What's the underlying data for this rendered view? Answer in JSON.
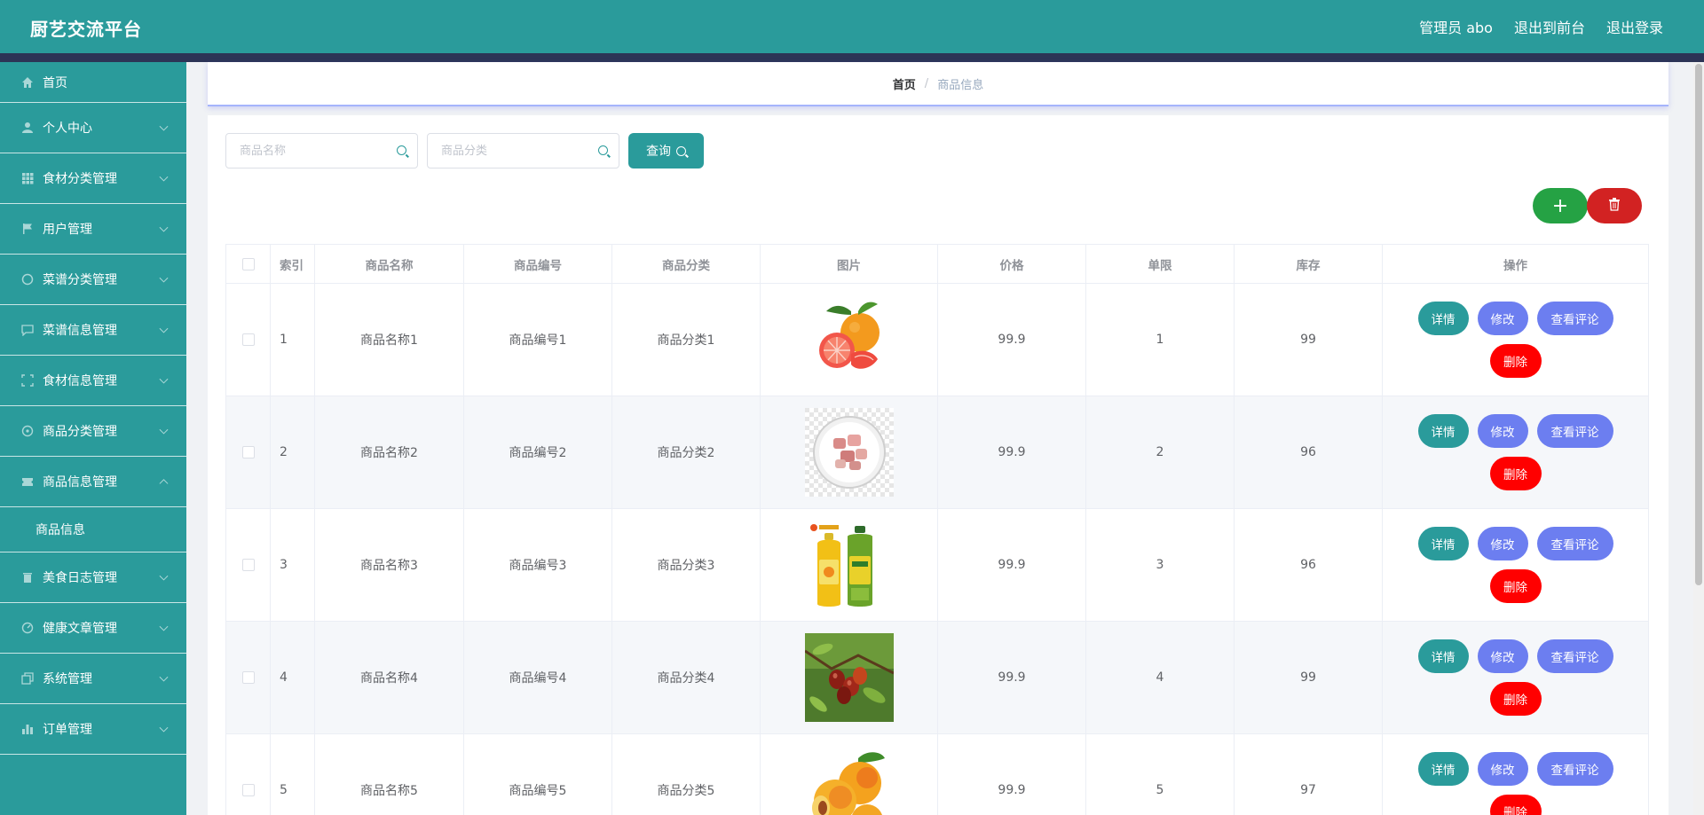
{
  "header": {
    "title": "厨艺交流平台",
    "user_label": "管理员 abo",
    "front_link": "退出到前台",
    "logout_link": "退出登录"
  },
  "sidebar": {
    "items": [
      {
        "label": "首页",
        "icon": "home-icon"
      },
      {
        "label": "个人中心",
        "icon": "user-icon"
      },
      {
        "label": "食材分类管理",
        "icon": "grid-icon"
      },
      {
        "label": "用户管理",
        "icon": "flag-icon"
      },
      {
        "label": "菜谱分类管理",
        "icon": "circle-icon"
      },
      {
        "label": "菜谱信息管理",
        "icon": "chat-icon"
      },
      {
        "label": "食材信息管理",
        "icon": "frame-icon"
      },
      {
        "label": "商品分类管理",
        "icon": "target-icon"
      },
      {
        "label": "商品信息管理",
        "icon": "ticket-icon"
      },
      {
        "label": "美食日志管理",
        "icon": "trash-icon"
      },
      {
        "label": "健康文章管理",
        "icon": "dashboard-icon"
      },
      {
        "label": "系统管理",
        "icon": "copy-icon"
      },
      {
        "label": "订单管理",
        "icon": "bars-icon"
      }
    ],
    "sub_item": "商品信息"
  },
  "breadcrumb": {
    "home": "首页",
    "sep": "/",
    "current": "商品信息"
  },
  "search": {
    "name_placeholder": "商品名称",
    "category_placeholder": "商品分类",
    "query_label": "查询"
  },
  "table": {
    "headers": [
      "索引",
      "商品名称",
      "商品编号",
      "商品分类",
      "图片",
      "价格",
      "单限",
      "库存",
      "操作"
    ],
    "rows": [
      {
        "index": "1",
        "name": "商品名称1",
        "code": "商品编号1",
        "category": "商品分类1",
        "image": "grapefruit",
        "price": "99.9",
        "limit": "1",
        "stock": "99"
      },
      {
        "index": "2",
        "name": "商品名称2",
        "code": "商品编号2",
        "category": "商品分类2",
        "image": "meat-plate",
        "price": "99.9",
        "limit": "2",
        "stock": "96"
      },
      {
        "index": "3",
        "name": "商品名称3",
        "code": "商品编号3",
        "category": "商品分类3",
        "image": "oil-bottles",
        "price": "99.9",
        "limit": "3",
        "stock": "96"
      },
      {
        "index": "4",
        "name": "商品名称4",
        "code": "商品编号4",
        "category": "商品分类4",
        "image": "jujubes",
        "price": "99.9",
        "limit": "4",
        "stock": "99"
      },
      {
        "index": "5",
        "name": "商品名称5",
        "code": "商品编号5",
        "category": "商品分类5",
        "image": "apricots",
        "price": "99.9",
        "limit": "5",
        "stock": "97"
      }
    ],
    "actions": {
      "detail": "详情",
      "edit": "修改",
      "review": "查看评论",
      "delete": "删除"
    }
  },
  "colors": {
    "primary": "#2a9b9b",
    "header_strip": "#2c3456",
    "add": "#25a244",
    "delete_bulk": "#d22222",
    "edit": "#6c7ef0",
    "delete_row": "#ff0000"
  }
}
